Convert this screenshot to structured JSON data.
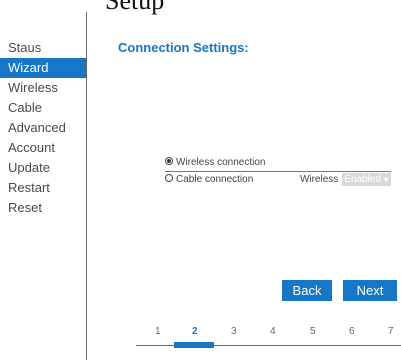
{
  "top_partial_text": "Setup",
  "sidebar": {
    "items": [
      {
        "label": "Staus"
      },
      {
        "label": "Wizard",
        "active": true
      },
      {
        "label": "Wireless"
      },
      {
        "label": "Cable"
      },
      {
        "label": "Advanced"
      },
      {
        "label": "Account"
      },
      {
        "label": "Update"
      },
      {
        "label": "Restart"
      },
      {
        "label": "Reset"
      }
    ]
  },
  "main": {
    "title": "Connection Settings:",
    "options": [
      {
        "label": "Wireless connection",
        "selected": true
      },
      {
        "label": "Cable connection",
        "selected": false
      }
    ],
    "wireless_label": "Wireless",
    "wireless_select_value": "Enabled"
  },
  "buttons": {
    "back": "Back",
    "next": "Next"
  },
  "steps": {
    "items": [
      "1",
      "2",
      "3",
      "4",
      "5",
      "6",
      "7"
    ],
    "active_index": 1
  },
  "colors": {
    "accent": "#1677c8"
  }
}
